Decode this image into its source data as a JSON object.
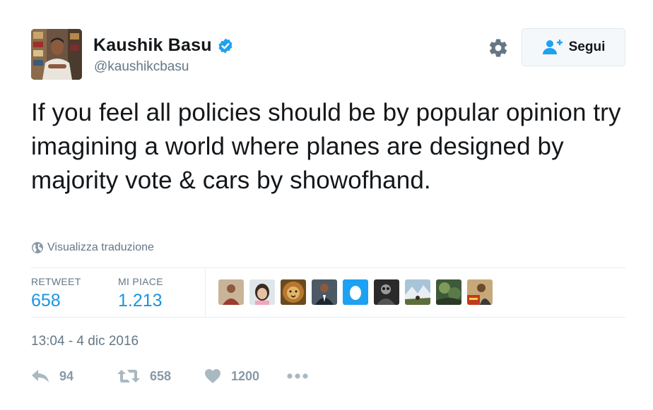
{
  "author": {
    "name": "Kaushik Basu",
    "handle": "@kaushikcbasu",
    "verified": true
  },
  "header": {
    "follow_label": "Segui",
    "settings_icon": "gear-icon",
    "follow_icon": "add-user-icon"
  },
  "tweet": {
    "text": "If you feel all policies should be by popular opinion try imagining a world where planes are designed by majority vote & cars by showofhand.",
    "translate_label": "Visualizza traduzione",
    "timestamp": "13:04 - 4 dic 2016"
  },
  "stats": {
    "retweets_label": "RETWEET",
    "retweets_value": "658",
    "likes_label": "MI PIACE",
    "likes_value": "1.213"
  },
  "actions": {
    "reply_count": "94",
    "retweet_count": "658",
    "like_count": "1200"
  },
  "colors": {
    "accent": "#1b95e0",
    "verified": "#1da1f2",
    "muted": "#657786",
    "action_grey": "#aab8c2"
  }
}
